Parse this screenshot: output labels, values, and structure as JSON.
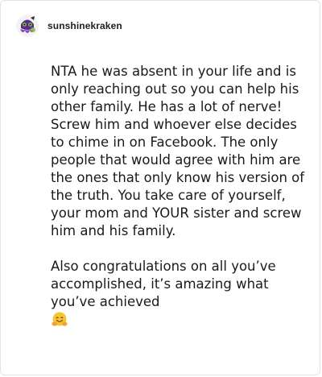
{
  "post": {
    "username": "sunshinekraken",
    "avatar_icon": "kraken-avatar-icon",
    "paragraphs": [
      "NTA he was absent in your life and is only reaching out so you can help his other family. He has a lot of nerve! Screw him and whoever else decides to chime in on Facebook. The only people that would agree with him are the ones that only know his version of the truth. You take care of yourself, your mom and YOUR sister and screw him and his family.",
      "Also congratulations on all you’ve accomplished, it’s amazing what you’ve achieved"
    ],
    "emoji": "hugging-face-emoji"
  },
  "colors": {
    "border": "#e3e3e3",
    "text": "#1a1a1a",
    "avatar_purple": "#7b3fa8",
    "avatar_green": "#7fc24a",
    "emoji_yellow": "#f7c531"
  }
}
